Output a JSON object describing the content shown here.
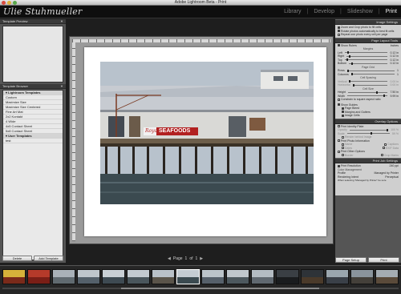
{
  "window": {
    "title": "Adobe Lightroom Beta - Print"
  },
  "identity_plate": "Ulie Stuhmueller",
  "modules": {
    "library": "Library",
    "develop": "Develop",
    "slideshow": "Slideshow",
    "print": "Print",
    "separator": "|"
  },
  "left_panel": {
    "template_preview_label": "Template Preview",
    "template_browser_label": "Template Browser",
    "templates": [
      "Custom",
      "Maximize Size",
      "Maximize Size Centered",
      "Fine Art Mat",
      "2x2 Kontakt",
      "4 Wide",
      "4x5 Contact Sheet",
      "5x8 Contact Sheet",
      "test"
    ],
    "delete_label": "Delete",
    "add_template_label": "Add Template"
  },
  "photo": {
    "sign_text_red": "Royal",
    "sign_text_white": "SEAFOODS"
  },
  "page_nav": {
    "page_label": "Page",
    "current": "1",
    "of_label": "of",
    "total": "1"
  },
  "right_panel": {
    "image_settings": "Image Settings",
    "zoom_crop": "Zoom and Crop photo to fill cells",
    "rotate": "Rotate photos automatically to best fit cells",
    "repeat": "Repeat one photo every cell per page",
    "page_layout": "Page Layout Tools",
    "show_rulers": "Show Rulers",
    "rulers_unit": "Inches",
    "margins": "Margins",
    "left": "Left",
    "left_val": "0.12 in",
    "right": "Right",
    "right_val": "0.12 in",
    "top": "Top",
    "top_val": "0.12 in",
    "bottom": "Bottom",
    "bottom_val": "0.12 in",
    "page_grid": "Page Grid",
    "rows": "Rows",
    "rows_val": "1",
    "columns": "Columns",
    "columns_val": "1",
    "cell_spacing": "Cell Spacing",
    "vertical": "Vertical",
    "vertical_val": "0.00 in",
    "horizontal": "Horizontal",
    "horizontal_val": "0.00 in",
    "cell_size": "Cell Size",
    "height": "Height",
    "height_val": "7.50 in",
    "width": "Width",
    "width_val": "9.99 in",
    "keep_square": "Constrain to square aspect ratio",
    "show_guides": "Show Guides",
    "page_bleed": "Page Bleed",
    "margins_gutters": "Margins and Gutters",
    "image_cells": "Image Cells",
    "overlay": "Overlay Options",
    "print_identity": "Print Identity Plate",
    "opacity": "Opacity",
    "opacity_val": "100 %",
    "scale": "Scale",
    "scale_val": "59 %",
    "render_behind": "Render behind image",
    "print_photo_info": "Print Photo Information",
    "name": "Name",
    "captions": "Captions",
    "dates": "Dates",
    "exif": "EXIF Data",
    "print_other": "Print Other Options",
    "border": "Border",
    "crop_marks": "Crop Marks",
    "print_job": "Print Job Settings",
    "print_resolution": "Print Resolution",
    "resolution_val": "240 ppi",
    "color_mgmt": "Color Management",
    "profile": "Profile",
    "profile_val": "Managed by Printer",
    "rendering": "Rendering Intent",
    "rendering_val": "Perceptual",
    "note": "When selecting \"Managed by Printer\" be sure",
    "page_setup": "Page Setup",
    "print": "Print"
  },
  "colors": {
    "accent": "#ffffff",
    "panel": "#555555",
    "toolbar": "#0e0e0e"
  }
}
